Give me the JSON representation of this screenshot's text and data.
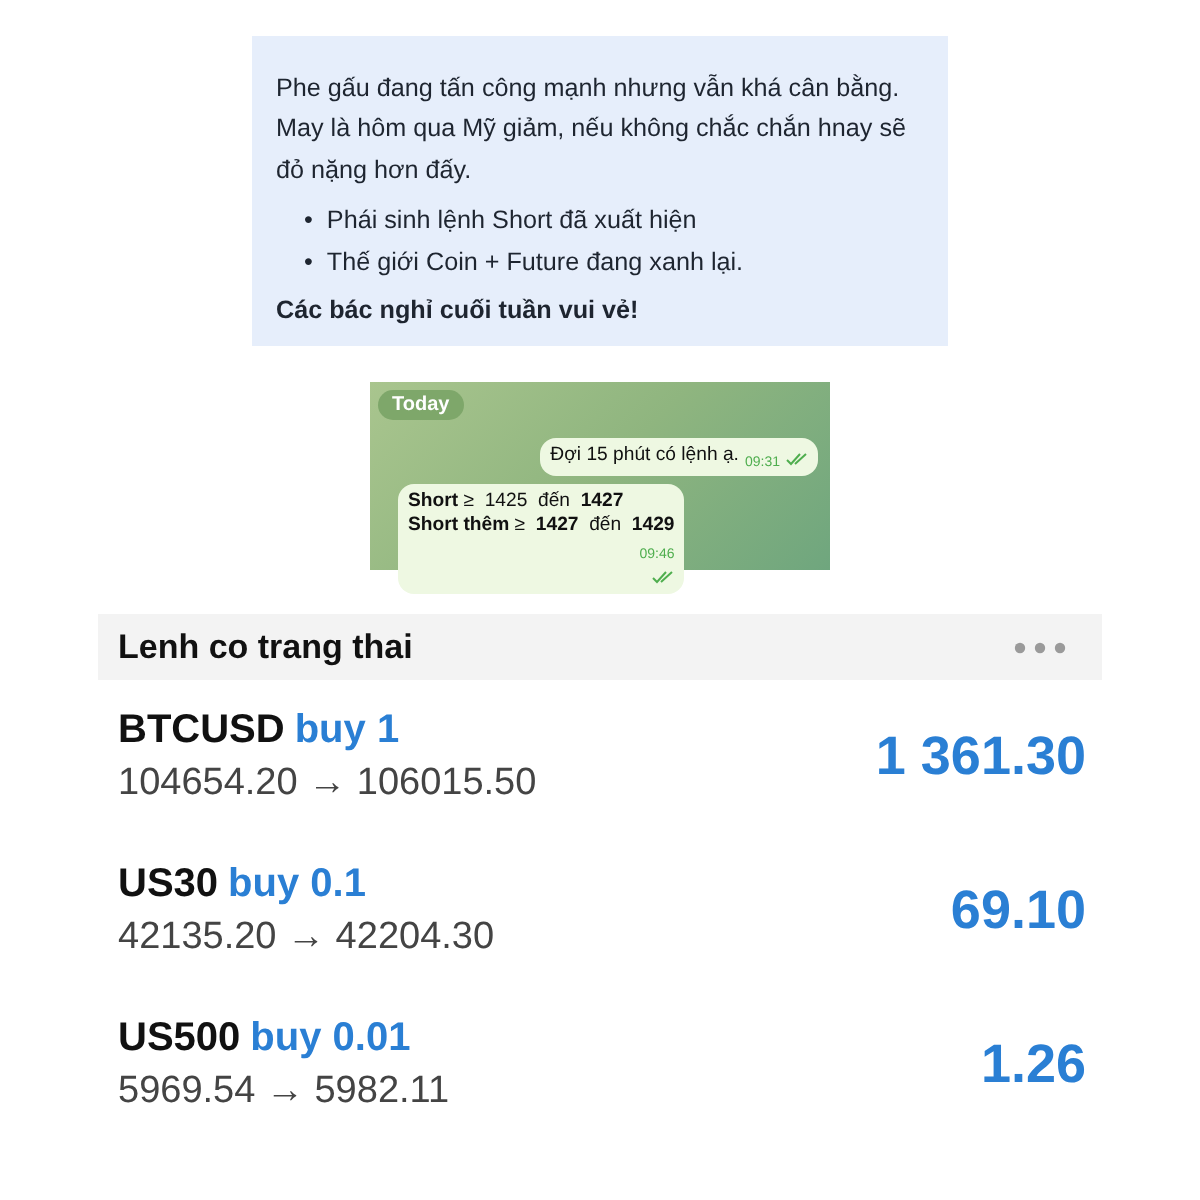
{
  "note": {
    "paragraph": "Phe gấu đang tấn công mạnh nhưng vẫn khá cân bằng. May là hôm qua Mỹ giảm, nếu không chắc chắn hnay sẽ đỏ nặng hơn đấy.",
    "bullets": [
      {
        "marker": "•",
        "text": "Phái sinh lệnh Short đã xuất hiện"
      },
      {
        "marker": "•",
        "text": "Thế giới Coin + Future đang xanh lại."
      }
    ],
    "closing": "Các bác nghỉ cuối tuần vui vẻ!"
  },
  "chat": {
    "date_badge": "Today",
    "messages": [
      {
        "lines": [
          "Đợi 15 phút có lệnh ạ."
        ],
        "time": "09:31"
      },
      {
        "lines": [
          "**Short** ≥  1425  đến  **1427**",
          "**Short thêm** ≥  **1427**  đến  **1429**"
        ],
        "time": "09:46"
      }
    ]
  },
  "positions": {
    "title": "Lenh co trang thai",
    "rows": [
      {
        "symbol": "BTCUSD",
        "side": "buy 1",
        "prices": "104654.20 → 106015.50",
        "profit": "1 361.30"
      },
      {
        "symbol": "US30",
        "side": "buy 0.1",
        "prices": "42135.20 → 42204.30",
        "profit": "69.10"
      },
      {
        "symbol": "US500",
        "side": "buy 0.01",
        "prices": "5969.54 → 5982.11",
        "profit": "1.26"
      }
    ]
  }
}
